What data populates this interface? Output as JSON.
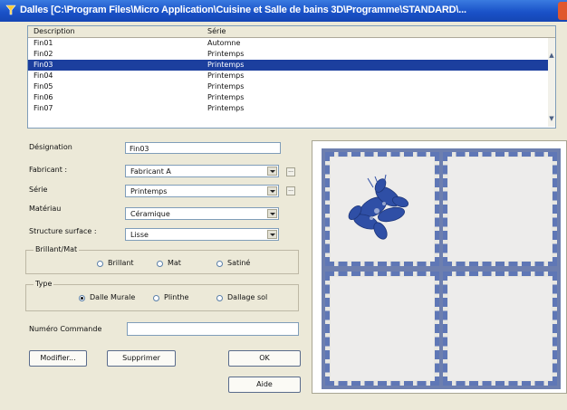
{
  "window": {
    "title": "Dalles [C:\\Program Files\\Micro Application\\Cuisine et Salle de bains 3D\\Programme\\STANDARD\\..."
  },
  "list": {
    "columns": [
      "Description",
      "Série"
    ],
    "rows": [
      {
        "description": "Fin01",
        "serie": "Automne"
      },
      {
        "description": "Fin02",
        "serie": "Printemps"
      },
      {
        "description": "Fin03",
        "serie": "Printemps"
      },
      {
        "description": "Fin04",
        "serie": "Printemps"
      },
      {
        "description": "Fin05",
        "serie": "Printemps"
      },
      {
        "description": "Fin06",
        "serie": "Printemps"
      },
      {
        "description": "Fin07",
        "serie": "Printemps"
      }
    ],
    "selected_index": 2
  },
  "form": {
    "designation_label": "Désignation",
    "designation_value": "Fin03",
    "fabricant_label": "Fabricant :",
    "fabricant_value": "Fabricant A",
    "serie_label": "Série",
    "serie_value": "Printemps",
    "materiau_label": "Matériau",
    "materiau_value": "Céramique",
    "structure_label": "Structure surface :",
    "structure_value": "Lisse",
    "more_button": "...",
    "brillant_group_title": "Brillant/Mat",
    "brillant_options": [
      "Brillant",
      "Mat",
      "Satiné"
    ],
    "brillant_selected": null,
    "type_group_title": "Type",
    "type_options": [
      "Dalle Murale",
      "Plinthe",
      "Dallage sol"
    ],
    "type_selected": 0,
    "commande_label": "Numéro Commande",
    "commande_value": ""
  },
  "buttons": {
    "modifier": "Modifier...",
    "supprimer": "Supprimer",
    "ok": "OK",
    "aide": "Aide"
  },
  "colors": {
    "selection": "#1c3f9e",
    "title_bar": "#1a52c8",
    "tile_border": "#5f77b6"
  }
}
